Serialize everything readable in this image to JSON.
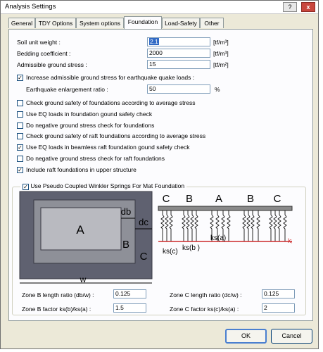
{
  "window": {
    "title": "Analysis Settings",
    "help_label": "?",
    "close_label": "x"
  },
  "tabs": [
    {
      "label": "General"
    },
    {
      "label": "TDY Options"
    },
    {
      "label": "System options"
    },
    {
      "label": "Foundation",
      "active": true
    },
    {
      "label": "Load-Safety"
    },
    {
      "label": "Other"
    }
  ],
  "fields": {
    "soil_unit_weight": {
      "label": "Soil unit weight :",
      "value": "2.1",
      "unit": "[tf/m³]"
    },
    "bedding_coefficient": {
      "label": "Bedding coefficient :",
      "value": "2000",
      "unit": "[tf/m³]"
    },
    "admissible_ground_stress": {
      "label": "Admissible ground stress :",
      "value": "15",
      "unit": "[tf/m²]"
    }
  },
  "increase_stress": {
    "label": "Increase admissible ground stress for earthquake quake loads :",
    "checked": true
  },
  "earthquake_ratio": {
    "label": "Earthquake enlargement ratio :",
    "value": "50",
    "unit": "%"
  },
  "checks": [
    {
      "label": "Check ground safety of foundations according to average stress",
      "checked": false
    },
    {
      "label": "Use EQ loads in foundation gound safety check",
      "checked": false
    },
    {
      "label": "Do negative ground stress check for foundations",
      "checked": false
    },
    {
      "label": "Check ground safety of raft foundations according to average stress",
      "checked": false
    },
    {
      "label": "Use EQ loads in beamless raft foundation gound safety check",
      "checked": true
    },
    {
      "label": "Do negative ground stress check for raft foundations",
      "checked": false
    },
    {
      "label": "Include raft foundations in upper structure",
      "checked": true
    }
  ],
  "winkler": {
    "label": "Use Pseudo Coupled Winkler Springs For Mat Foundation",
    "checked": true
  },
  "diagram": {
    "plan": {
      "zone_a": "A",
      "zone_b": "B",
      "zone_c": "C",
      "db": "db",
      "dc": "dc",
      "w": "w"
    },
    "section": {
      "zones": [
        "C",
        "B",
        "A",
        "B",
        "C"
      ],
      "ks_c": "ks(c)",
      "ks_b": "ks(b )",
      "ks_a": "ks(a)",
      "ki": "kᵢ"
    }
  },
  "zone_fields": {
    "zone_b_length": {
      "label": "Zone B length ratio (db/w) :",
      "value": "0.125"
    },
    "zone_b_factor": {
      "label": "Zone B factor ks(b)/ks(a) :",
      "value": "1.5"
    },
    "zone_c_length": {
      "label": "Zone C length ratio (dc/w) :",
      "value": "0.125"
    },
    "zone_c_factor": {
      "label": "Zone C factor ks(c)/ks(a) :",
      "value": "2"
    }
  },
  "buttons": {
    "ok": "OK",
    "cancel": "Cancel"
  }
}
